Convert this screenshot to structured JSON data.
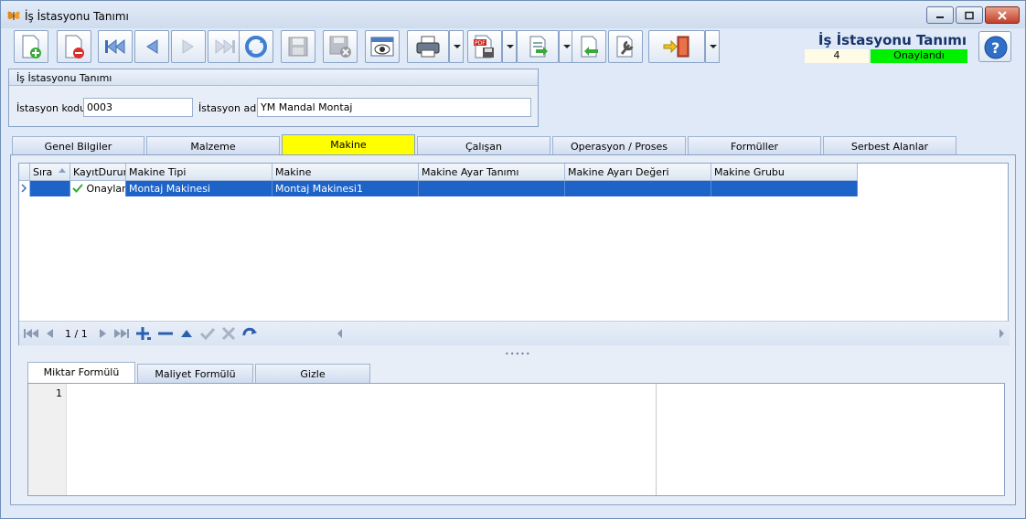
{
  "window": {
    "title": "İş İstasyonu Tanımı"
  },
  "document": {
    "title": "İş İstasyonu Tanımı",
    "number": "4",
    "status": "Onaylandı",
    "status_color": "#00f000"
  },
  "toolbar": {
    "icons": [
      "new-document-icon",
      "delete-document-icon",
      "first-record-icon",
      "previous-record-icon",
      "next-record-icon",
      "last-record-icon",
      "refresh-icon",
      "save-icon",
      "save-close-icon",
      "preview-icon",
      "print-icon",
      "pdf-export-icon",
      "export-icon",
      "import-icon",
      "tools-icon",
      "exit-icon"
    ]
  },
  "station_group": {
    "header": "İş İstasyonu Tanımı",
    "code_label": "İstasyon kodu",
    "code_value": "0003",
    "name_label": "İstasyon adı",
    "name_value": "YM Mandal Montaj"
  },
  "tabs": [
    {
      "label": "Genel Bilgiler"
    },
    {
      "label": "Malzeme"
    },
    {
      "label": "Makine"
    },
    {
      "label": "Çalışan"
    },
    {
      "label": "Operasyon / Proses"
    },
    {
      "label": "Formüller"
    },
    {
      "label": "Serbest Alanlar"
    }
  ],
  "active_tab_color": "#ffff00",
  "grid": {
    "columns": [
      "Sıra",
      "KayıtDurum",
      "Makine Tipi",
      "Makine",
      "Makine Ayar Tanımı",
      "Makine Ayarı Değeri",
      "Makine Grubu"
    ],
    "rows": [
      {
        "sira": "",
        "durum": "Onaylar",
        "makine_tipi": "Montaj Makinesi",
        "makine": "Montaj Makinesi1",
        "ayar_tanimi": "",
        "ayar_degeri": "",
        "grubu": ""
      }
    ],
    "selection_color": "#1e63c8",
    "pager": "1 / 1"
  },
  "subtabs": [
    {
      "label": "Miktar Formülü"
    },
    {
      "label": "Maliyet Formülü"
    },
    {
      "label": "Gizle"
    }
  ],
  "editor": {
    "line_number": "1"
  }
}
